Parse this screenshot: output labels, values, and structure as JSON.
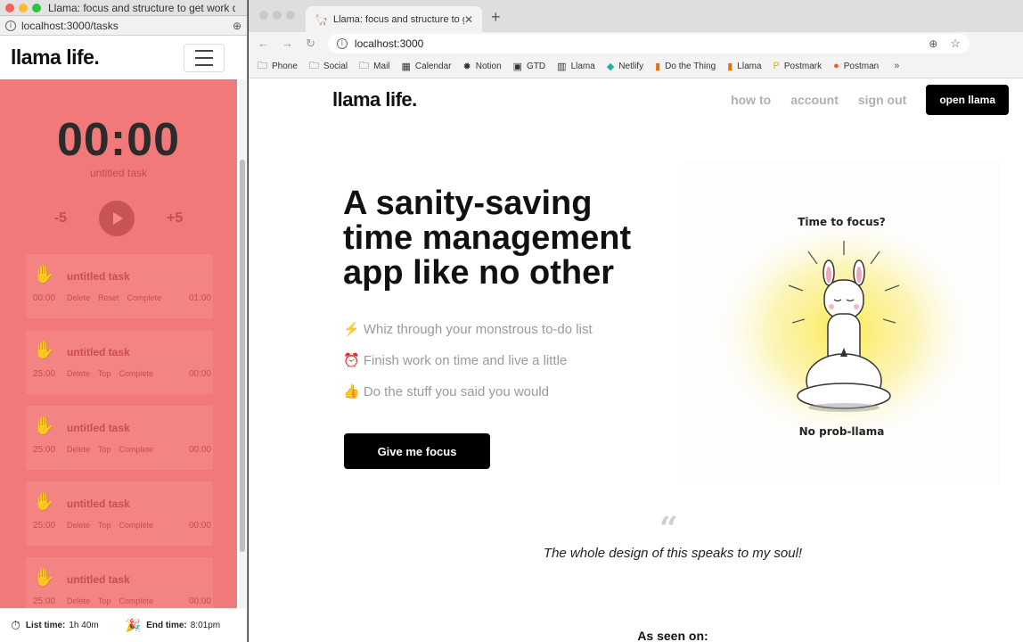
{
  "popup": {
    "window_title": "Llama: focus and structure to get work do...",
    "url": "localhost:3000/tasks",
    "logo": "llama life.",
    "timer": "00:00",
    "timer_task": "untitled task",
    "minus": "-5",
    "plus": "+5",
    "tasks": [
      {
        "name": "untitled task",
        "time": "00:00",
        "actions": [
          "Delete",
          "Reset",
          "Complete"
        ],
        "end": "01:00"
      },
      {
        "name": "untitled task",
        "time": "25:00",
        "actions": [
          "Delete",
          "Top",
          "Complete"
        ],
        "end": "00:00"
      },
      {
        "name": "untitled task",
        "time": "25:00",
        "actions": [
          "Delete",
          "Top",
          "Complete"
        ],
        "end": "00:00"
      },
      {
        "name": "untitled task",
        "time": "25:00",
        "actions": [
          "Delete",
          "Top",
          "Complete"
        ],
        "end": "00:00"
      },
      {
        "name": "untitled task",
        "time": "25:00",
        "actions": [
          "Delete",
          "Top",
          "Complete"
        ],
        "end": "00:00"
      }
    ],
    "footer": {
      "list_label": "List time:",
      "list_value": "1h 40m",
      "end_label": "End time:",
      "end_value": "8:01pm"
    }
  },
  "browser": {
    "tab_title": "Llama: focus and structure to g",
    "url": "localhost:3000",
    "bookmarks": [
      "Phone",
      "Social",
      "Mail",
      "Calendar",
      "Notion",
      "GTD",
      "Llama",
      "Netlify",
      "Do the Thing",
      "Llama",
      "Postmark",
      "Postman"
    ]
  },
  "site": {
    "logo": "llama life.",
    "nav": [
      "how to",
      "account",
      "sign out"
    ],
    "open_button": "open llama",
    "hero_title": "A sanity-saving time management app like no other",
    "bullets": [
      "⚡ Whiz through your monstrous to-do list",
      "⏰ Finish work on time and live a little",
      "👍 Do the stuff you said you would"
    ],
    "cta": "Give me focus",
    "illustration_top": "Time to focus?",
    "illustration_bottom": "No prob-llama",
    "quote": "The whole design of this speaks to my soul!",
    "seen_on": "As seen on:"
  }
}
